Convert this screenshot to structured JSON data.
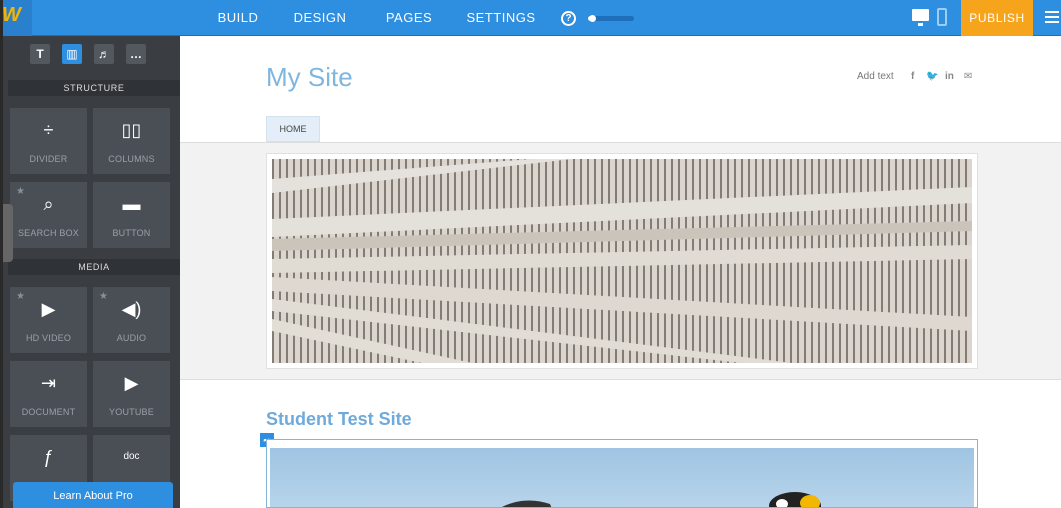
{
  "topbar": {
    "logo_glyph": "W",
    "nav": [
      "BUILD",
      "DESIGN",
      "PAGES",
      "SETTINGS"
    ],
    "help_glyph": "?",
    "setup_progress": 0.1,
    "publish_label": "PUBLISH",
    "icons": [
      "desktop-view-icon",
      "mobile-view-icon",
      "menu-icon"
    ]
  },
  "sidebar": {
    "tool_tabs": [
      "T",
      "▥",
      "♬",
      "…"
    ],
    "sections": [
      {
        "label": "STRUCTURE"
      },
      {
        "label": "MEDIA"
      }
    ],
    "tiles": [
      {
        "label": "DIVIDER",
        "icon": "divider-icon",
        "glyph": "÷",
        "starred": false
      },
      {
        "label": "COLUMNS",
        "icon": "columns-icon",
        "glyph": "▯▯",
        "starred": false
      },
      {
        "label": "SEARCH BOX",
        "icon": "search-icon",
        "glyph": "⌕",
        "starred": true
      },
      {
        "label": "BUTTON",
        "icon": "button-icon",
        "glyph": "▬",
        "starred": false
      },
      {
        "label": "HD VIDEO",
        "icon": "video-icon",
        "glyph": "▶",
        "starred": true
      },
      {
        "label": "AUDIO",
        "icon": "audio-icon",
        "glyph": "◀)",
        "starred": true
      },
      {
        "label": "DOCUMENT",
        "icon": "document-icon",
        "glyph": "⇥",
        "starred": false
      },
      {
        "label": "YOUTUBE",
        "icon": "youtube-icon",
        "glyph": "▶",
        "starred": false
      },
      {
        "label": "",
        "icon": "flash-icon",
        "glyph": "ƒ",
        "starred": false
      },
      {
        "label": "",
        "icon": "doc-embed-icon",
        "glyph": "doc",
        "starred": false
      }
    ],
    "star_glyph": "★",
    "learn_pro_label": "Learn About Pro"
  },
  "canvas": {
    "site_title": "My Site",
    "header_text": "Add text",
    "social": [
      "f",
      "🐦",
      "in",
      "✉"
    ],
    "home_tab": "HOME",
    "section_title": "Student Test Site",
    "edit_glyph": "➦"
  },
  "colors": {
    "accent": "#2e8ee0",
    "publish": "#f7a41d",
    "sidebar_bg": "#3a3d42",
    "title": "#7fb6df"
  }
}
